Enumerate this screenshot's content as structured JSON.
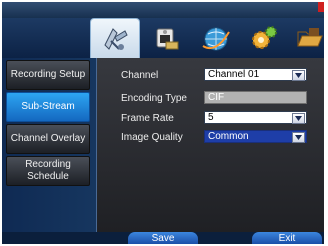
{
  "sidebar": {
    "items": [
      {
        "label": "Recording Setup"
      },
      {
        "label": "Sub-Stream"
      },
      {
        "label": "Channel Overlay"
      },
      {
        "label": "Recording Schedule"
      }
    ],
    "active_index": 1
  },
  "form": {
    "channel_label": "Channel",
    "channel_value": "Channel 01",
    "encoding_label": "Encoding Type",
    "encoding_value": "CIF",
    "framerate_label": "Frame Rate",
    "framerate_value": "5",
    "quality_label": "Image Quality",
    "quality_value": "Common"
  },
  "buttons": {
    "save_label": "Save",
    "exit_label": "Exit"
  },
  "toolbar": {
    "icons": [
      "satellite-icon",
      "camera-icon",
      "network-icon",
      "gear-icon",
      "folder-icon"
    ]
  },
  "colors": {
    "active_tab": "#2a8fe8",
    "selected_field": "#1e3ea8"
  }
}
